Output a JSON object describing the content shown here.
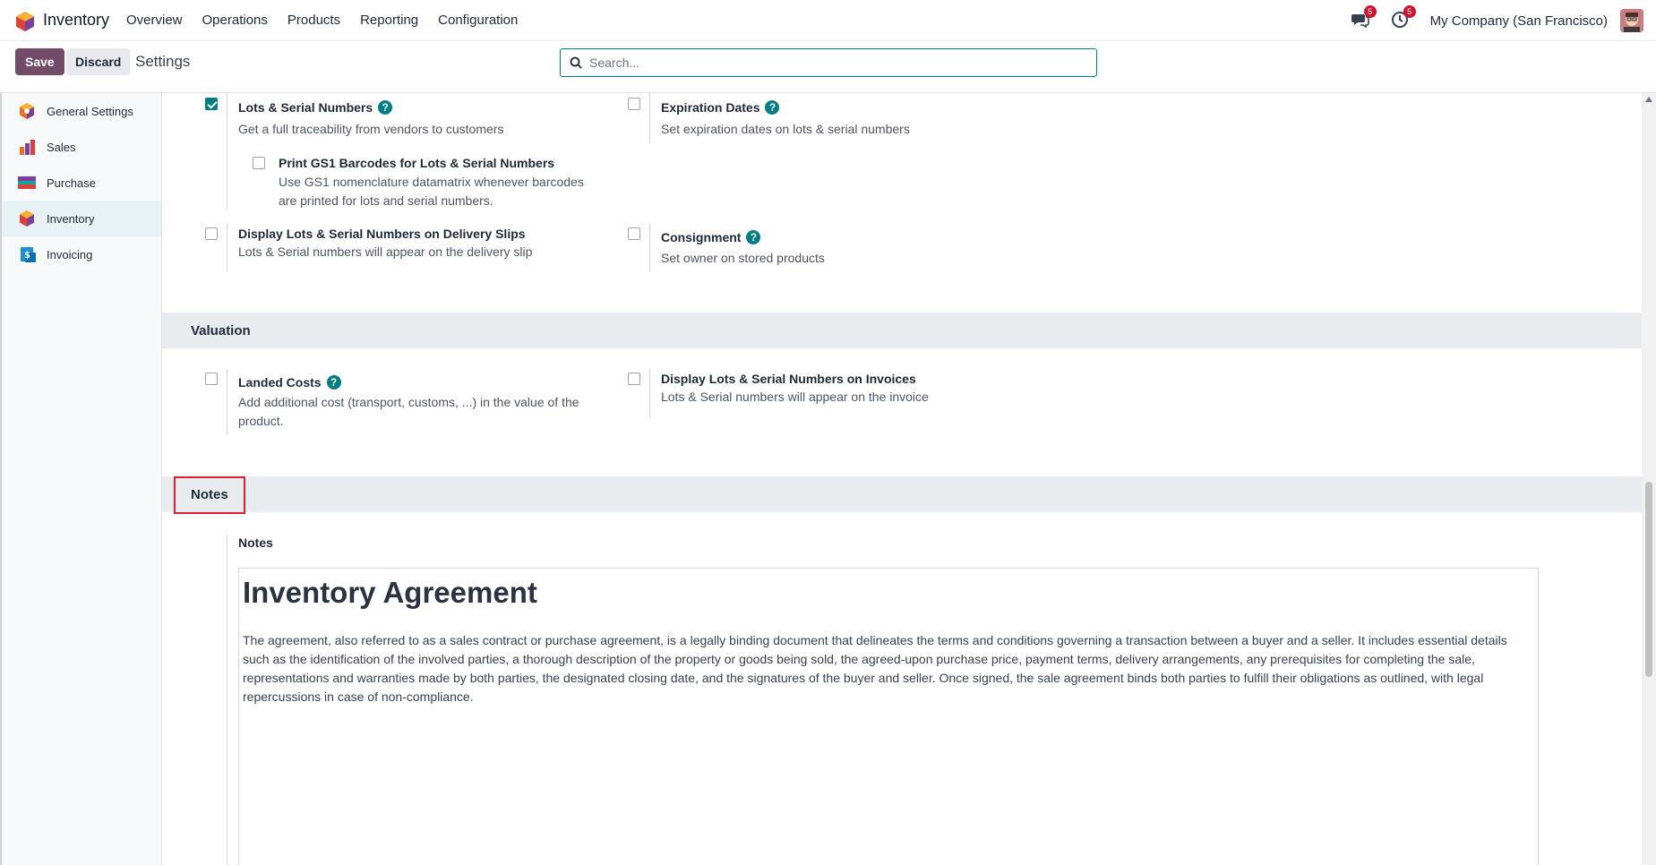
{
  "navbar": {
    "app_name": "Inventory",
    "menu": [
      "Overview",
      "Operations",
      "Products",
      "Reporting",
      "Configuration"
    ],
    "messages_badge": "5",
    "activities_badge": "5",
    "company": "My Company (San Francisco)"
  },
  "control": {
    "save_label": "Save",
    "discard_label": "Discard",
    "breadcrumb": "Settings",
    "search_placeholder": "Search..."
  },
  "sidebar": {
    "items": [
      {
        "label": "General Settings",
        "icon": "general-settings-icon",
        "active": false
      },
      {
        "label": "Sales",
        "icon": "sales-icon",
        "active": false
      },
      {
        "label": "Purchase",
        "icon": "purchase-icon",
        "active": false
      },
      {
        "label": "Inventory",
        "icon": "inventory-icon",
        "active": true
      },
      {
        "label": "Invoicing",
        "icon": "invoicing-icon",
        "active": false
      }
    ]
  },
  "settings": {
    "lots": {
      "title": "Lots & Serial Numbers",
      "desc": "Get a full traceability from vendors to customers",
      "checked": true
    },
    "expiration": {
      "title": "Expiration Dates",
      "desc": "Set expiration dates on lots & serial numbers",
      "checked": false
    },
    "gs1": {
      "title": "Print GS1 Barcodes for Lots & Serial Numbers",
      "desc": "Use GS1 nomenclature datamatrix whenever barcodes are printed for lots and serial numbers.",
      "checked": false
    },
    "delivery_slips": {
      "title": "Display Lots & Serial Numbers on Delivery Slips",
      "desc": "Lots & Serial numbers will appear on the delivery slip",
      "checked": false
    },
    "consignment": {
      "title": "Consignment",
      "desc": "Set owner on stored products",
      "checked": false
    },
    "landed_costs": {
      "title": "Landed Costs",
      "desc": "Add additional cost (transport, customs, ...) in the value of the product.",
      "checked": false
    },
    "invoices": {
      "title": "Display Lots & Serial Numbers on Invoices",
      "desc": "Lots & Serial numbers will appear on the invoice",
      "checked": false
    }
  },
  "sections": {
    "valuation": "Valuation",
    "notes": "Notes"
  },
  "notes": {
    "label": "Notes",
    "heading": "Inventory Agreement",
    "body": "The agreement, also referred to as a sales contract or purchase agreement, is a legally binding document that delineates the terms and conditions governing a transaction between a buyer and a seller. It includes essential details such as the identification of the involved parties, a thorough description of the property or goods being sold, the agreed-upon purchase price, payment terms, delivery arrangements, any prerequisites for completing the sale, representations and warranties made by both parties, the designated closing date, and the signatures of the buyer and seller. Once signed, the sale agreement binds both parties to fulfill their obligations as outlined, with legal repercussions in case of non-compliance."
  },
  "colors": {
    "brand": "#714b67",
    "accent": "#017e84",
    "highlight": "#e11d2f"
  }
}
